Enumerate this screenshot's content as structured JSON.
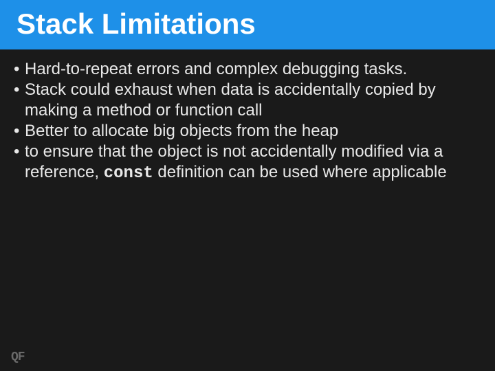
{
  "slide": {
    "title": "Stack Limitations",
    "bullets": [
      {
        "text": "Hard-to-repeat errors and complex debugging tasks."
      },
      {
        "text": "Stack could exhaust when data is accidentally copied by making a method or function call"
      },
      {
        "text": "Better to allocate big objects from the heap"
      },
      {
        "pre": "to ensure that the object is not accidentally modified via a\nreference, ",
        "code": "const",
        "post": " definition can be used where applicable"
      }
    ],
    "footer_mark": "QF"
  }
}
